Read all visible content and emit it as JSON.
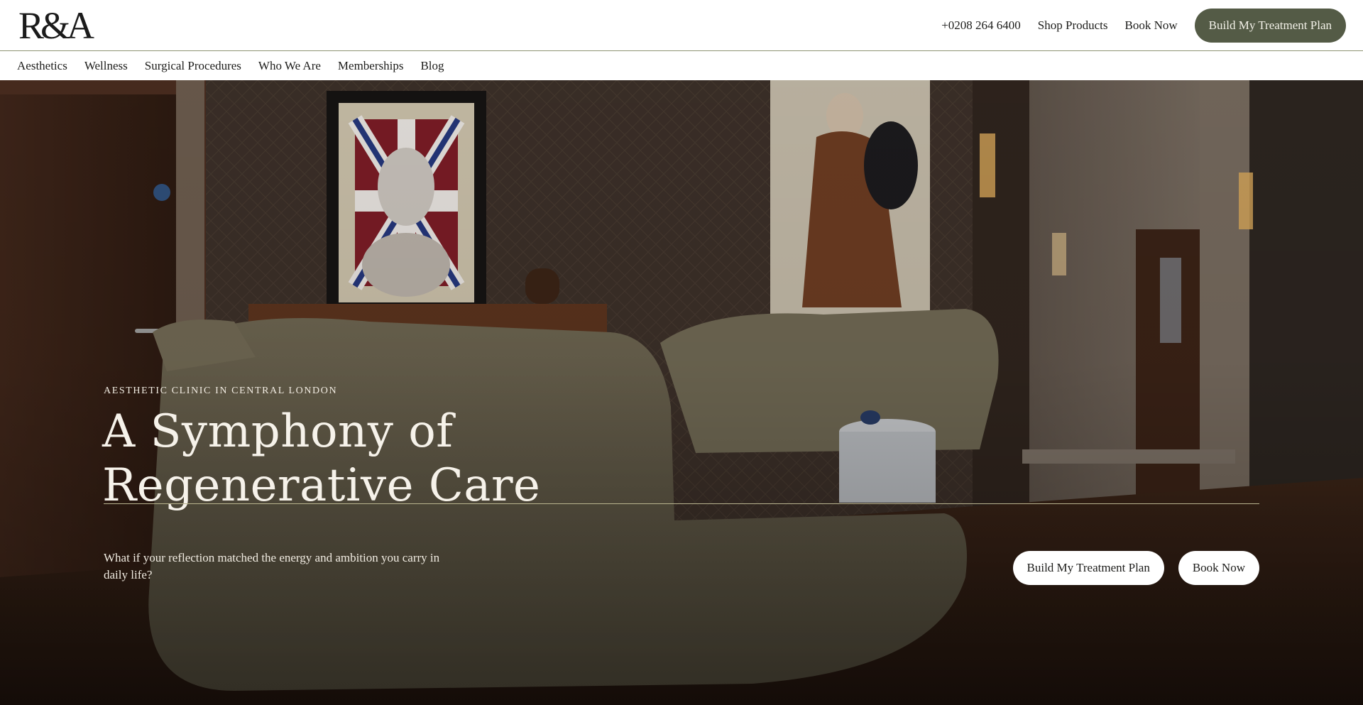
{
  "header": {
    "logo_text": "R&A",
    "phone": "+0208 264 6400",
    "shop_label": "Shop Products",
    "book_label": "Book Now",
    "cta_label": "Build My Treatment Plan"
  },
  "nav": {
    "items": [
      {
        "label": "Aesthetics"
      },
      {
        "label": "Wellness"
      },
      {
        "label": "Surgical Procedures"
      },
      {
        "label": "Who We Are"
      },
      {
        "label": "Memberships"
      },
      {
        "label": "Blog"
      }
    ]
  },
  "hero": {
    "eyebrow": "AESTHETIC CLINIC IN CENTRAL LONDON",
    "headline_line1": "A Symphony of",
    "headline_line2": "Regenerative Care",
    "subtext": "What if your reflection matched the energy and ambition you carry in daily life?",
    "primary_button": "Build My Treatment Plan",
    "secondary_button": "Book Now"
  },
  "colors": {
    "brand_olive": "#545b46",
    "rule_gold": "#b9b48f"
  }
}
